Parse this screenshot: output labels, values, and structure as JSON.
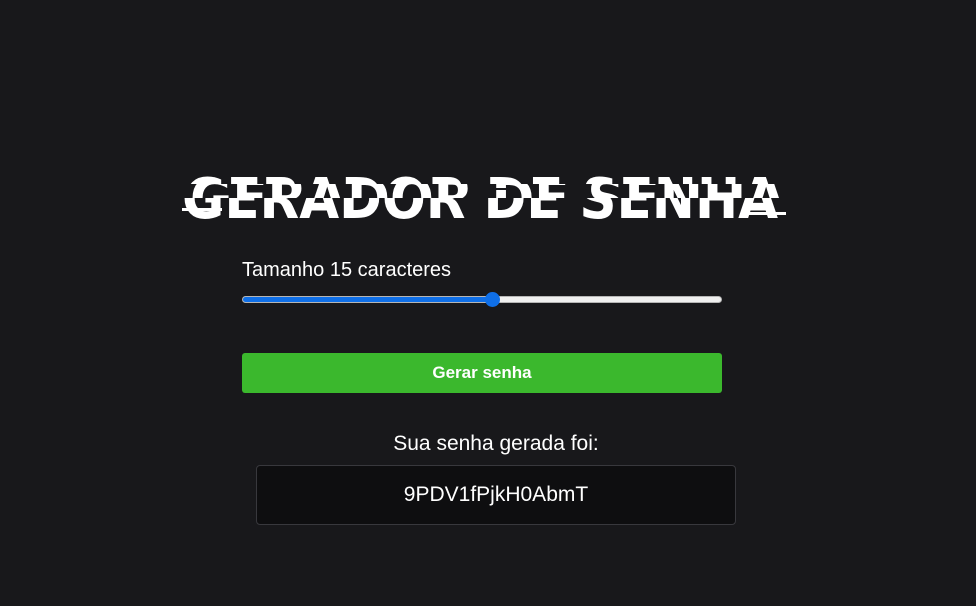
{
  "app": {
    "title": "GERADOR DE SENHA"
  },
  "length": {
    "label_prefix": "Tamanho",
    "value": "15",
    "label_suffix": "caracteres",
    "slider_fraction": 0.52
  },
  "generate": {
    "button_label": "Gerar senha"
  },
  "result": {
    "label": "Sua senha gerada foi:",
    "password": "9PDV1fPjkH0AbmT"
  },
  "colors": {
    "background": "#18181b",
    "accent_slider": "#0f6fe8",
    "button_green": "#3bb82d",
    "result_box": "#0e0e10"
  }
}
